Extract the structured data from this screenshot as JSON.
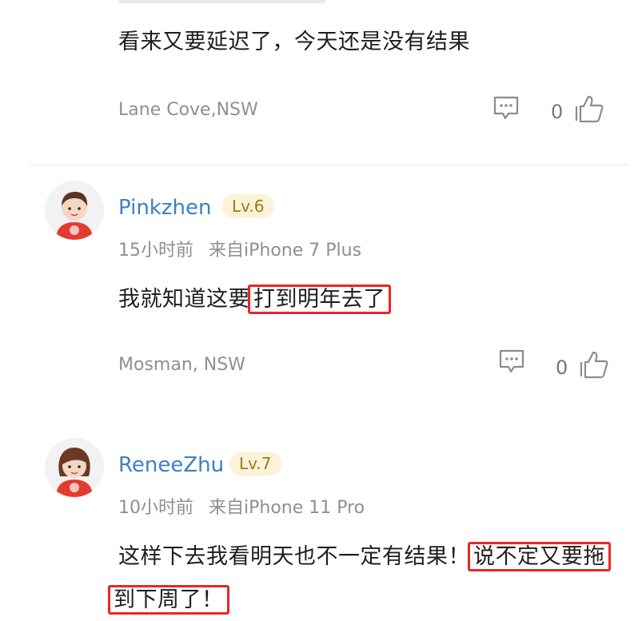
{
  "comments": [
    {
      "text": "看来又要延迟了，今天还是没有结果",
      "location": "Lane Cove,NSW",
      "like_count": "0"
    },
    {
      "username": "Pinkzhen",
      "level": "Lv.6",
      "time": "15小时前",
      "device": "来自iPhone 7 Plus",
      "text_plain": "我就知道这要",
      "text_highlight": "打到明年去了",
      "location": "Mosman, NSW",
      "like_count": "0"
    },
    {
      "username": "ReneeZhu",
      "level": "Lv.7",
      "time": "10小时前",
      "device": "来自iPhone 11 Pro",
      "text_plain": "这样下去我看明天也不一定有结果！",
      "text_highlight_1": "说不定又要拖",
      "text_highlight_2": "到下周了！"
    }
  ],
  "colors": {
    "username": "#3f7fc4",
    "highlight_box": "#e8262a",
    "level_badge_bg": "#fbf3d8",
    "level_badge_text": "#9a7a1c"
  },
  "icons": {
    "reply": "comment-bubble-icon",
    "like": "thumbs-up-icon",
    "avatar_male": "avatar-boy",
    "avatar_female": "avatar-girl"
  }
}
